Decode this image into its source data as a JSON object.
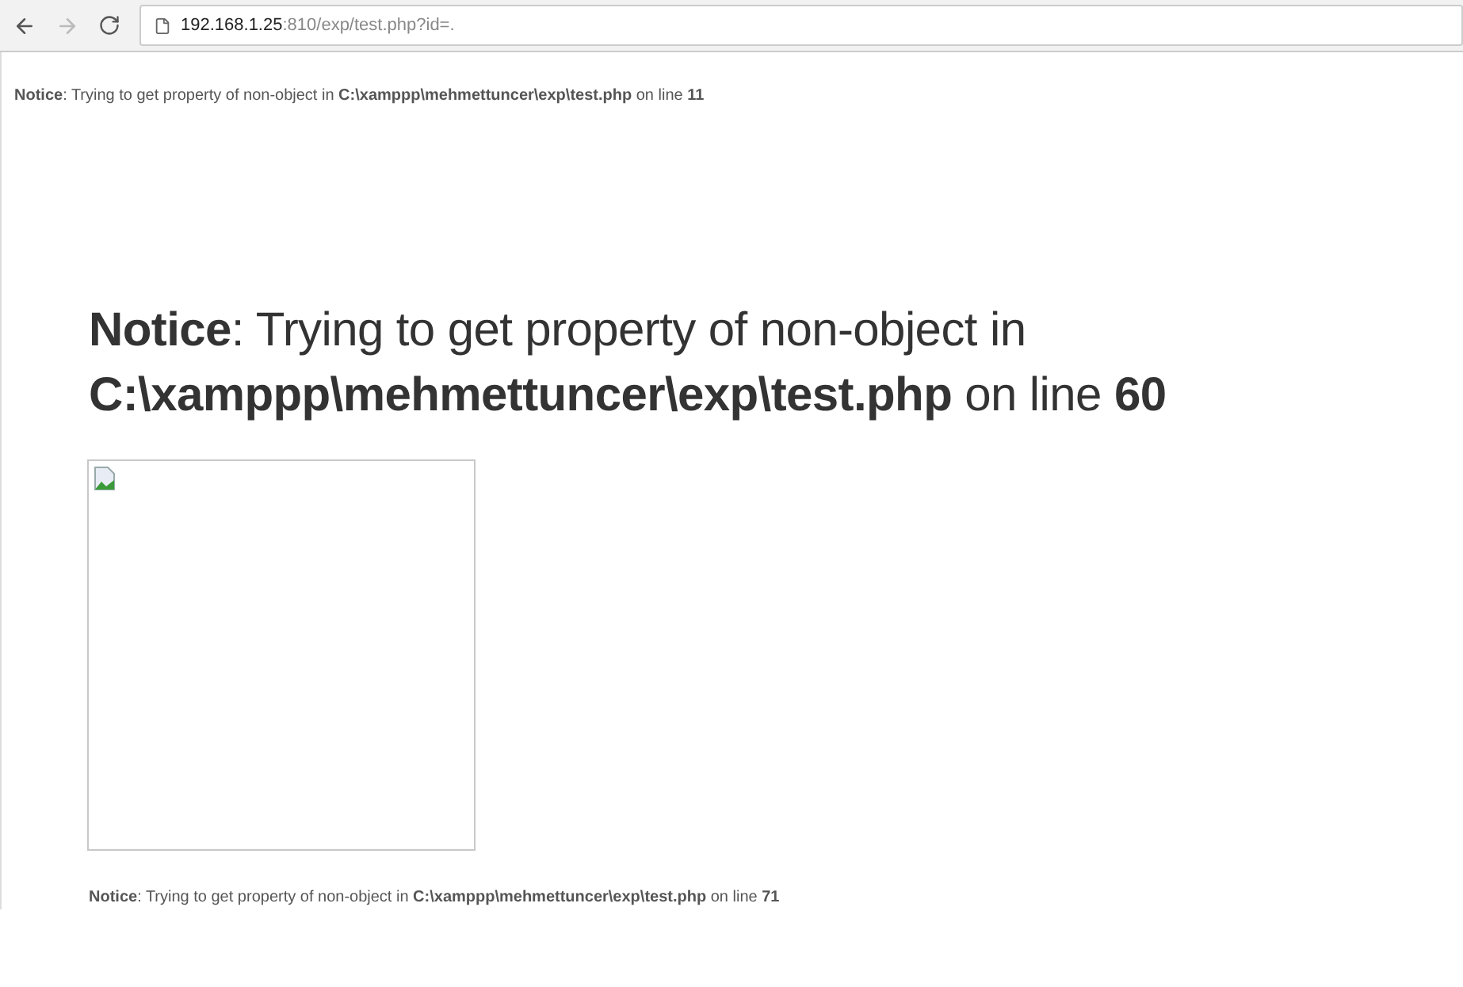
{
  "address_bar": {
    "host": "192.168.1.25",
    "path": ":810/exp/test.php?id=."
  },
  "notices": [
    {
      "kind": "small",
      "text": "**Notice**: Trying to get property of non-object in **C:\\xamppp\\mehmettuncer\\exp\\test.php** on line **11**"
    },
    {
      "kind": "large",
      "text": "**Notice**: Trying to get property of non-object in **C:\\xamppp\\mehmettuncer\\exp\\test.php** on line **60**"
    },
    {
      "kind": "image"
    },
    {
      "kind": "small",
      "text": "**Notice**: Trying to get property of non-object in **C:\\xamppp\\mehmettuncer\\exp\\test.php** on line **71**"
    }
  ]
}
